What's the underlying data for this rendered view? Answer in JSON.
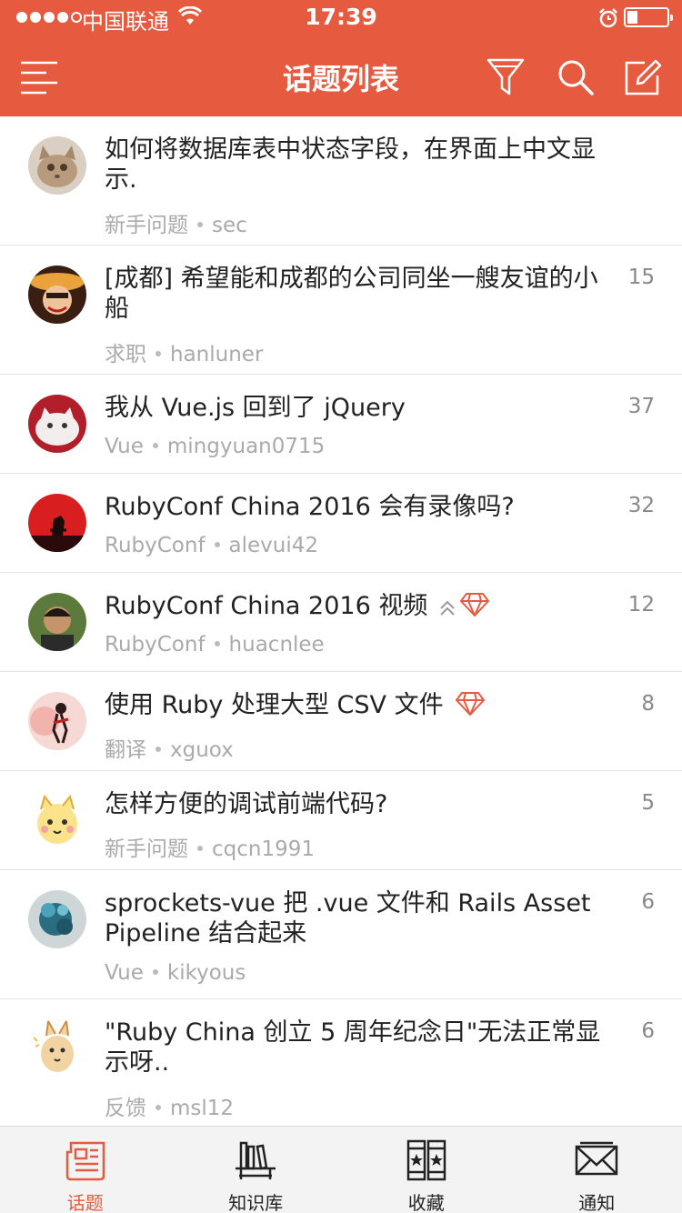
{
  "status_bar": {
    "carrier": "中国联通",
    "time": "17:39",
    "battery_level": 0.25
  },
  "navbar": {
    "title": "话题列表",
    "icons": [
      "menu-icon",
      "filter-icon",
      "search-icon",
      "compose-icon"
    ]
  },
  "topics": [
    {
      "title": "如何将数据库表中状态字段，在界面上中文显示.",
      "node": "新手问题",
      "author": "sec",
      "replies": ""
    },
    {
      "title": "[成都] 希望能和成都的公司同坐一艘友谊的小船",
      "node": "求职",
      "author": "hanluner",
      "replies": "15"
    },
    {
      "title": "我从 Vue.js 回到了 jQuery",
      "node": "Vue",
      "author": "mingyuan0715",
      "replies": "37"
    },
    {
      "title": "RubyConf China 2016 会有录像吗?",
      "node": "RubyConf",
      "author": "alevui42",
      "replies": "32"
    },
    {
      "title": "RubyConf China 2016 视频",
      "node": "RubyConf",
      "author": "huacnlee",
      "replies": "12",
      "badges": [
        "upvote-icon",
        "diamond-icon"
      ]
    },
    {
      "title": "使用 Ruby 处理大型 CSV 文件",
      "node": "翻译",
      "author": "xguox",
      "replies": "8",
      "badges": [
        "diamond-icon"
      ]
    },
    {
      "title": "怎样方便的调试前端代码?",
      "node": "新手问题",
      "author": "cqcn1991",
      "replies": "5"
    },
    {
      "title": "sprockets-vue 把 .vue 文件和 Rails Asset Pipeline 结合起来",
      "node": "Vue",
      "author": "kikyous",
      "replies": "6"
    },
    {
      "title": "\"Ruby China 创立 5 周年纪念日\"无法正常显示呀..",
      "node": "反馈",
      "author": "msl12",
      "replies": "6"
    }
  ],
  "tabbar": {
    "tabs": [
      {
        "label": "话题",
        "icon": "newspaper-icon",
        "active": true
      },
      {
        "label": "知识库",
        "icon": "bookshelf-icon",
        "active": false
      },
      {
        "label": "收藏",
        "icon": "starred-books-icon",
        "active": false
      },
      {
        "label": "通知",
        "icon": "envelope-icon",
        "active": false
      }
    ]
  },
  "colors": {
    "brand": "#e65a3f",
    "meta_text": "#aaaaaa",
    "tabbar_bg": "#f4f3f3"
  }
}
